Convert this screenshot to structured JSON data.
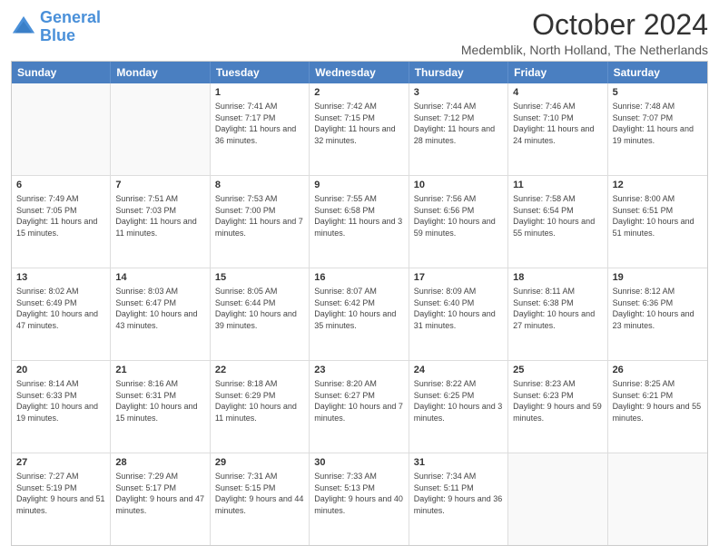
{
  "logo": {
    "text1": "General",
    "text2": "Blue"
  },
  "header": {
    "month": "October 2024",
    "location": "Medemblik, North Holland, The Netherlands"
  },
  "weekdays": [
    "Sunday",
    "Monday",
    "Tuesday",
    "Wednesday",
    "Thursday",
    "Friday",
    "Saturday"
  ],
  "weeks": [
    [
      {
        "day": "",
        "sunrise": "",
        "sunset": "",
        "daylight": ""
      },
      {
        "day": "",
        "sunrise": "",
        "sunset": "",
        "daylight": ""
      },
      {
        "day": "1",
        "sunrise": "Sunrise: 7:41 AM",
        "sunset": "Sunset: 7:17 PM",
        "daylight": "Daylight: 11 hours and 36 minutes."
      },
      {
        "day": "2",
        "sunrise": "Sunrise: 7:42 AM",
        "sunset": "Sunset: 7:15 PM",
        "daylight": "Daylight: 11 hours and 32 minutes."
      },
      {
        "day": "3",
        "sunrise": "Sunrise: 7:44 AM",
        "sunset": "Sunset: 7:12 PM",
        "daylight": "Daylight: 11 hours and 28 minutes."
      },
      {
        "day": "4",
        "sunrise": "Sunrise: 7:46 AM",
        "sunset": "Sunset: 7:10 PM",
        "daylight": "Daylight: 11 hours and 24 minutes."
      },
      {
        "day": "5",
        "sunrise": "Sunrise: 7:48 AM",
        "sunset": "Sunset: 7:07 PM",
        "daylight": "Daylight: 11 hours and 19 minutes."
      }
    ],
    [
      {
        "day": "6",
        "sunrise": "Sunrise: 7:49 AM",
        "sunset": "Sunset: 7:05 PM",
        "daylight": "Daylight: 11 hours and 15 minutes."
      },
      {
        "day": "7",
        "sunrise": "Sunrise: 7:51 AM",
        "sunset": "Sunset: 7:03 PM",
        "daylight": "Daylight: 11 hours and 11 minutes."
      },
      {
        "day": "8",
        "sunrise": "Sunrise: 7:53 AM",
        "sunset": "Sunset: 7:00 PM",
        "daylight": "Daylight: 11 hours and 7 minutes."
      },
      {
        "day": "9",
        "sunrise": "Sunrise: 7:55 AM",
        "sunset": "Sunset: 6:58 PM",
        "daylight": "Daylight: 11 hours and 3 minutes."
      },
      {
        "day": "10",
        "sunrise": "Sunrise: 7:56 AM",
        "sunset": "Sunset: 6:56 PM",
        "daylight": "Daylight: 10 hours and 59 minutes."
      },
      {
        "day": "11",
        "sunrise": "Sunrise: 7:58 AM",
        "sunset": "Sunset: 6:54 PM",
        "daylight": "Daylight: 10 hours and 55 minutes."
      },
      {
        "day": "12",
        "sunrise": "Sunrise: 8:00 AM",
        "sunset": "Sunset: 6:51 PM",
        "daylight": "Daylight: 10 hours and 51 minutes."
      }
    ],
    [
      {
        "day": "13",
        "sunrise": "Sunrise: 8:02 AM",
        "sunset": "Sunset: 6:49 PM",
        "daylight": "Daylight: 10 hours and 47 minutes."
      },
      {
        "day": "14",
        "sunrise": "Sunrise: 8:03 AM",
        "sunset": "Sunset: 6:47 PM",
        "daylight": "Daylight: 10 hours and 43 minutes."
      },
      {
        "day": "15",
        "sunrise": "Sunrise: 8:05 AM",
        "sunset": "Sunset: 6:44 PM",
        "daylight": "Daylight: 10 hours and 39 minutes."
      },
      {
        "day": "16",
        "sunrise": "Sunrise: 8:07 AM",
        "sunset": "Sunset: 6:42 PM",
        "daylight": "Daylight: 10 hours and 35 minutes."
      },
      {
        "day": "17",
        "sunrise": "Sunrise: 8:09 AM",
        "sunset": "Sunset: 6:40 PM",
        "daylight": "Daylight: 10 hours and 31 minutes."
      },
      {
        "day": "18",
        "sunrise": "Sunrise: 8:11 AM",
        "sunset": "Sunset: 6:38 PM",
        "daylight": "Daylight: 10 hours and 27 minutes."
      },
      {
        "day": "19",
        "sunrise": "Sunrise: 8:12 AM",
        "sunset": "Sunset: 6:36 PM",
        "daylight": "Daylight: 10 hours and 23 minutes."
      }
    ],
    [
      {
        "day": "20",
        "sunrise": "Sunrise: 8:14 AM",
        "sunset": "Sunset: 6:33 PM",
        "daylight": "Daylight: 10 hours and 19 minutes."
      },
      {
        "day": "21",
        "sunrise": "Sunrise: 8:16 AM",
        "sunset": "Sunset: 6:31 PM",
        "daylight": "Daylight: 10 hours and 15 minutes."
      },
      {
        "day": "22",
        "sunrise": "Sunrise: 8:18 AM",
        "sunset": "Sunset: 6:29 PM",
        "daylight": "Daylight: 10 hours and 11 minutes."
      },
      {
        "day": "23",
        "sunrise": "Sunrise: 8:20 AM",
        "sunset": "Sunset: 6:27 PM",
        "daylight": "Daylight: 10 hours and 7 minutes."
      },
      {
        "day": "24",
        "sunrise": "Sunrise: 8:22 AM",
        "sunset": "Sunset: 6:25 PM",
        "daylight": "Daylight: 10 hours and 3 minutes."
      },
      {
        "day": "25",
        "sunrise": "Sunrise: 8:23 AM",
        "sunset": "Sunset: 6:23 PM",
        "daylight": "Daylight: 9 hours and 59 minutes."
      },
      {
        "day": "26",
        "sunrise": "Sunrise: 8:25 AM",
        "sunset": "Sunset: 6:21 PM",
        "daylight": "Daylight: 9 hours and 55 minutes."
      }
    ],
    [
      {
        "day": "27",
        "sunrise": "Sunrise: 7:27 AM",
        "sunset": "Sunset: 5:19 PM",
        "daylight": "Daylight: 9 hours and 51 minutes."
      },
      {
        "day": "28",
        "sunrise": "Sunrise: 7:29 AM",
        "sunset": "Sunset: 5:17 PM",
        "daylight": "Daylight: 9 hours and 47 minutes."
      },
      {
        "day": "29",
        "sunrise": "Sunrise: 7:31 AM",
        "sunset": "Sunset: 5:15 PM",
        "daylight": "Daylight: 9 hours and 44 minutes."
      },
      {
        "day": "30",
        "sunrise": "Sunrise: 7:33 AM",
        "sunset": "Sunset: 5:13 PM",
        "daylight": "Daylight: 9 hours and 40 minutes."
      },
      {
        "day": "31",
        "sunrise": "Sunrise: 7:34 AM",
        "sunset": "Sunset: 5:11 PM",
        "daylight": "Daylight: 9 hours and 36 minutes."
      },
      {
        "day": "",
        "sunrise": "",
        "sunset": "",
        "daylight": ""
      },
      {
        "day": "",
        "sunrise": "",
        "sunset": "",
        "daylight": ""
      }
    ]
  ]
}
